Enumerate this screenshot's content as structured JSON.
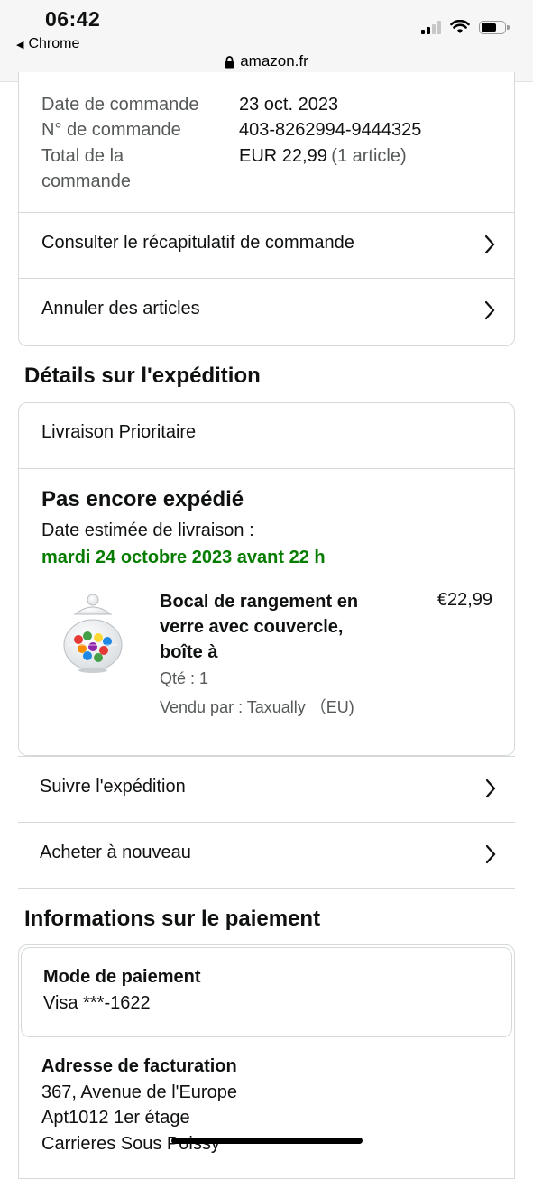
{
  "status_bar": {
    "time": "06:42",
    "back_app": "Chrome",
    "url": "amazon.fr"
  },
  "order": {
    "date_label": "Date de commande",
    "date_value": "23 oct. 2023",
    "number_label": "N° de commande",
    "number_value": "403-8262994-9444325",
    "total_label_line1": "Total de la",
    "total_label_line2": "commande",
    "total_value": "EUR 22,99",
    "total_count": "(1 article)",
    "summary_link": "Consulter le récapitulatif de commande",
    "cancel_link": "Annuler des articles"
  },
  "shipping": {
    "section_title": "Détails sur l'expédition",
    "method": "Livraison Prioritaire",
    "status": "Pas encore expédié",
    "estimate_label": "Date estimée de livraison :",
    "estimate_value": "mardi 24 octobre 2023 avant 22 h",
    "item": {
      "title_line1": "Bocal de rangement en",
      "title_line2": "verre avec couvercle,",
      "title_line3": "boîte à",
      "price": "€22,99",
      "qty": "Qté : 1",
      "seller": "Vendu par : Taxually （EU)"
    },
    "track_link": "Suivre l'expédition",
    "buy_again_link": "Acheter à nouveau"
  },
  "payment": {
    "section_title": "Informations sur le paiement",
    "method_label": "Mode de paiement",
    "method_value": "Visa ***-1622",
    "billing_label": "Adresse de facturation",
    "address_line1": "367, Avenue de l'Europe",
    "address_line2": "Apt1012 1er étage",
    "address_line3": "Carrieres Sous Poissy"
  },
  "colors": {
    "accent_green": "#067d00",
    "border": "#d5d9d9",
    "text": "#0f1111",
    "muted": "#565959"
  }
}
